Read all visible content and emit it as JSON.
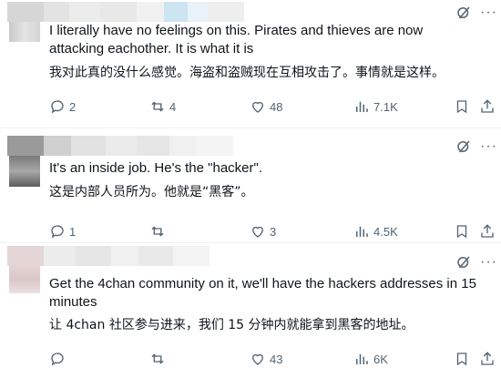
{
  "colors": {
    "text": "#0f1419",
    "muted": "#536471",
    "divider": "#eff3f4"
  },
  "posts": [
    {
      "text_en": "I literally have no feelings on this. Pirates and thieves are now attacking eachother. It is what it is",
      "text_zh": "我对此真的没什么感觉。海盗和盗贼现在互相攻击了。事情就是这样。",
      "replies": "2",
      "reposts": "4",
      "likes": "48",
      "views": "7.1K"
    },
    {
      "text_en": "It's an inside job. He's the \"hacker\".",
      "text_zh": "这是内部人员所为。他就是“黑客”。",
      "replies": "1",
      "reposts": "",
      "likes": "3",
      "views": "4.5K"
    },
    {
      "text_en": "Get the 4chan community on it, we'll have the hackers addresses in 15 minutes",
      "text_zh": "让 4chan 社区参与进来，我们 15 分钟内就能拿到黑客的地址。",
      "replies": "",
      "reposts": "",
      "likes": "43",
      "views": "6K"
    }
  ],
  "icons": [
    "reply-icon",
    "repost-icon",
    "like-icon",
    "views-icon",
    "bookmark-icon",
    "share-icon",
    "grok-icon",
    "more-icon"
  ]
}
